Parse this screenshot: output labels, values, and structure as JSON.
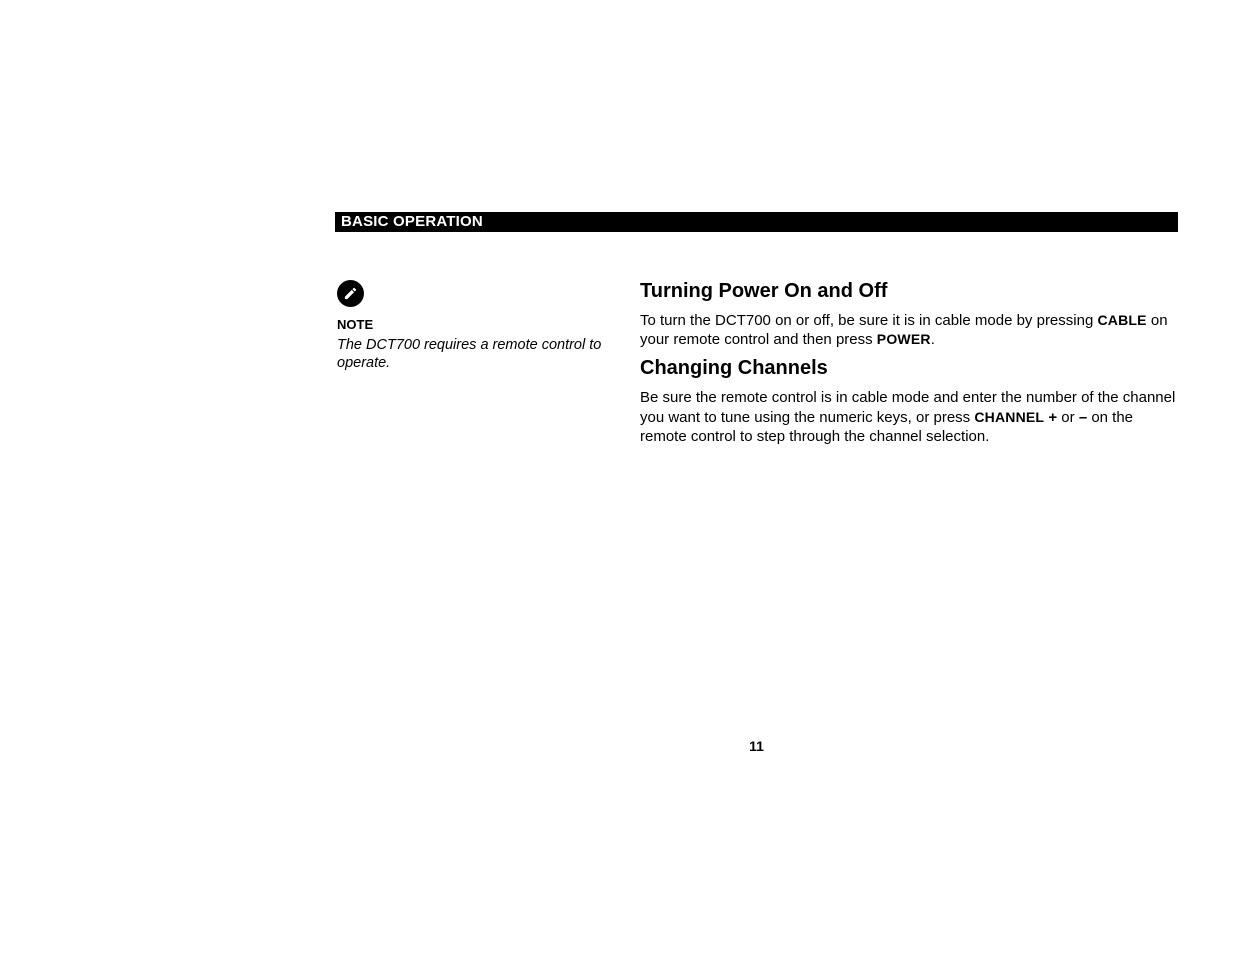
{
  "header": {
    "section_title": "BASIC OPERATION"
  },
  "sidebar": {
    "note_label": "NOTE",
    "note_text": "The DCT700 requires a remote control to operate."
  },
  "main": {
    "h1": "Turning Power On and Off",
    "p1_a": "To turn the DCT700 on or off, be sure it is in cable mode by pressing ",
    "p1_cable": "CABLE",
    "p1_b": " on your remote control and then press ",
    "p1_power": "POWER",
    "p1_c": ".",
    "h2": "Changing Channels",
    "p2_a": "Be sure the remote control is in cable mode and enter the number of the channel you want to tune using the numeric keys, or press ",
    "p2_channel": "CHANNEL",
    "p2_plus": " +",
    "p2_or": " or ",
    "p2_minus": "–",
    "p2_b": " on the remote control to step through the channel selection."
  },
  "footer": {
    "page_number": "11"
  }
}
